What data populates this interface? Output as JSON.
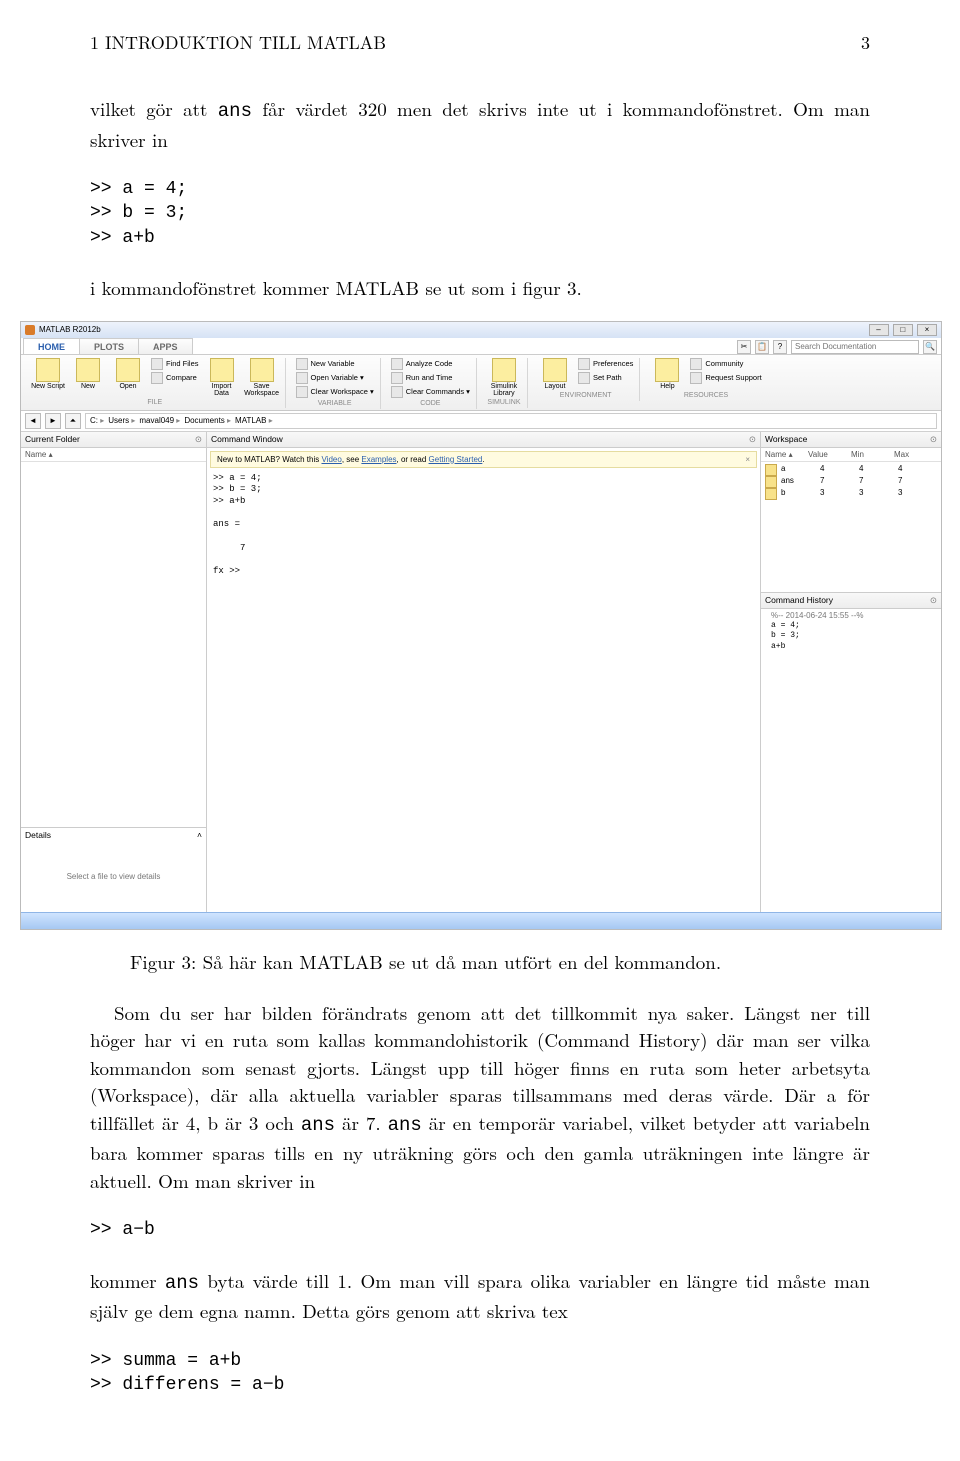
{
  "header": {
    "section": "1   INTRODUKTION TILL MATLAB",
    "page": "3"
  },
  "para1_a": "vilket gör att ",
  "para1_tt": "ans",
  "para1_b": " får värdet 320 men det skrivs inte ut i kommandofönstret. Om man skriver in",
  "code1": ">> a = 4;\n>> b = 3;\n>> a+b",
  "para2": "i kommandofönstret kommer MATLAB se ut som i figur 3.",
  "fig_caption": "Figur 3: Så här kan MATLAB se ut då man utfört en del kommandon.",
  "para3_a": "Som du ser har bilden förändrats genom att det tillkommit nya saker. Längst ner till höger har vi en ruta som kallas kommandohistorik (Command History) där man ser vilka kommandon som senast gjorts. Längst upp till höger finns en ruta som heter arbetsyta (Workspace), där alla aktuella variabler sparas tillsammans med deras värde. Där a för tillfället är 4, b är 3 och ",
  "para3_tt1": "ans",
  "para3_b": " är 7. ",
  "para3_tt2": "ans",
  "para3_c": " är en temporär variabel, vilket betyder att variabeln bara kommer sparas tills en ny uträkning görs och den gamla uträkningen inte längre är aktuell. Om man skriver in",
  "code2": ">> a−b",
  "para4_a": "kommer ",
  "para4_tt": "ans",
  "para4_b": " byta värde till 1. Om man vill spara olika variabler en längre tid måste man själv ge dem egna namn. Detta görs genom att skriva tex",
  "code3": ">> summa = a+b\n>> differens = a−b",
  "matlab": {
    "title": "MATLAB R2012b",
    "tabs": [
      "HOME",
      "PLOTS",
      "APPS"
    ],
    "search_placeholder": "Search Documentation",
    "ribbon": {
      "file": {
        "btns": [
          "New Script",
          "New",
          "Open",
          "Compare",
          "Import Data",
          "Save Workspace"
        ],
        "mini": [
          "Find Files"
        ],
        "label": "FILE"
      },
      "var": {
        "mini": [
          "New Variable",
          "Open Variable  ▾",
          "Clear Workspace  ▾"
        ],
        "label": "VARIABLE"
      },
      "code": {
        "mini": [
          "Analyze Code",
          "Run and Time",
          "Clear Commands  ▾"
        ],
        "label": "CODE"
      },
      "simu": {
        "btns": [
          "Simulink Library"
        ],
        "label": "SIMULINK"
      },
      "env": {
        "btns": [
          "Layout"
        ],
        "mini": [
          "Preferences",
          "Set Path"
        ],
        "label": "ENVIRONMENT"
      },
      "res": {
        "btns": [
          "Help"
        ],
        "mini": [
          "Community",
          "Request Support"
        ],
        "label": "RESOURCES"
      }
    },
    "path": [
      "C:",
      "Users",
      "maval049",
      "Documents",
      "MATLAB"
    ],
    "left": {
      "title": "Current Folder",
      "col": "Name ▴",
      "details": "Details",
      "note": "Select a file to view details"
    },
    "center": {
      "title": "Command Window",
      "tip_a": "New to MATLAB? Watch this ",
      "tip_l1": "Video",
      "tip_b": ", see ",
      "tip_l2": "Examples",
      "tip_c": ", or read ",
      "tip_l3": "Getting Started",
      "tip_d": ".",
      "content": ">> a = 4;\n>> b = 3;\n>> a+b\n\nans =\n\n     7\n\nfx >> "
    },
    "right": {
      "ws_title": "Workspace",
      "cols": [
        "Name ▴",
        "Value",
        "Min",
        "Max"
      ],
      "rows": [
        {
          "name": "a",
          "value": "4",
          "min": "4",
          "max": "4"
        },
        {
          "name": "ans",
          "value": "7",
          "min": "7",
          "max": "7"
        },
        {
          "name": "b",
          "value": "3",
          "min": "3",
          "max": "3"
        }
      ],
      "ch_title": "Command History",
      "ch_header": "%-- 2014-06-24 15:55 --%",
      "ch_lines": [
        "a = 4;",
        "b = 3;",
        "a+b"
      ]
    }
  }
}
